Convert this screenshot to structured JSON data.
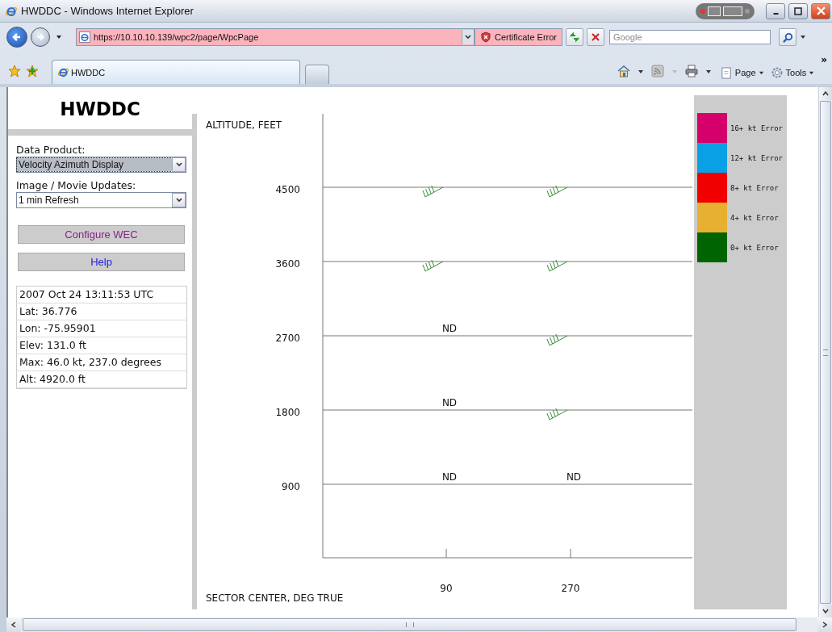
{
  "window": {
    "title": "HWDDC - Windows Internet Explorer"
  },
  "address_bar": {
    "url": "https://10.10.10.139/wpc2/page/WpcPage",
    "certificate_status": "Certificate Error"
  },
  "search": {
    "placeholder": "Google"
  },
  "tabs": [
    {
      "label": "HWDDC",
      "selected": true
    }
  ],
  "command_bar": {
    "items": [
      {
        "label": "Page"
      },
      {
        "label": "Tools"
      }
    ],
    "overflow": "»"
  },
  "sidebar": {
    "title": "HWDDC",
    "fields": [
      {
        "label": "Data Product:",
        "value": "Velocity Azimuth Display",
        "focused": true
      },
      {
        "label": "Image / Movie Updates:",
        "value": "1 min Refresh",
        "focused": false
      }
    ],
    "buttons": [
      {
        "label": "Configure WEC",
        "visited": true
      },
      {
        "label": "Help",
        "visited": false
      }
    ],
    "info": [
      "2007 Oct 24 13:11:53 UTC",
      "Lat: 36.776",
      "Lon: -75.95901",
      "Elev: 131.0 ft",
      "Max: 46.0 kt, 237.0 degrees",
      "Alt: 4920.0 ft"
    ]
  },
  "vad": {
    "y_title": "ALTITUDE, FEET",
    "x_title": "SECTOR CENTER, DEG TRUE",
    "sectors": [
      "90",
      "270"
    ],
    "rows": [
      {
        "altitude": "4500",
        "cells": [
          {
            "kind": "barb"
          },
          {
            "kind": "barb"
          }
        ]
      },
      {
        "altitude": "3600",
        "cells": [
          {
            "kind": "barb"
          },
          {
            "kind": "barb"
          }
        ]
      },
      {
        "altitude": "2700",
        "cells": [
          {
            "kind": "nd",
            "text": "ND"
          },
          {
            "kind": "barb"
          }
        ]
      },
      {
        "altitude": "1800",
        "cells": [
          {
            "kind": "nd",
            "text": "ND"
          },
          {
            "kind": "barb"
          }
        ]
      },
      {
        "altitude": "900",
        "cells": [
          {
            "kind": "nd",
            "text": "ND"
          },
          {
            "kind": "nd",
            "text": "ND"
          }
        ]
      }
    ]
  },
  "legend": [
    {
      "label": "16+ kt Error",
      "color": "#d6006b"
    },
    {
      "label": "12+ kt Error",
      "color": "#0aa0e6"
    },
    {
      "label": "8+ kt Error",
      "color": "#f00000"
    },
    {
      "label": "4+ kt Error",
      "color": "#e6b030"
    },
    {
      "label": "0+ kt Error",
      "color": "#006400"
    }
  ]
}
